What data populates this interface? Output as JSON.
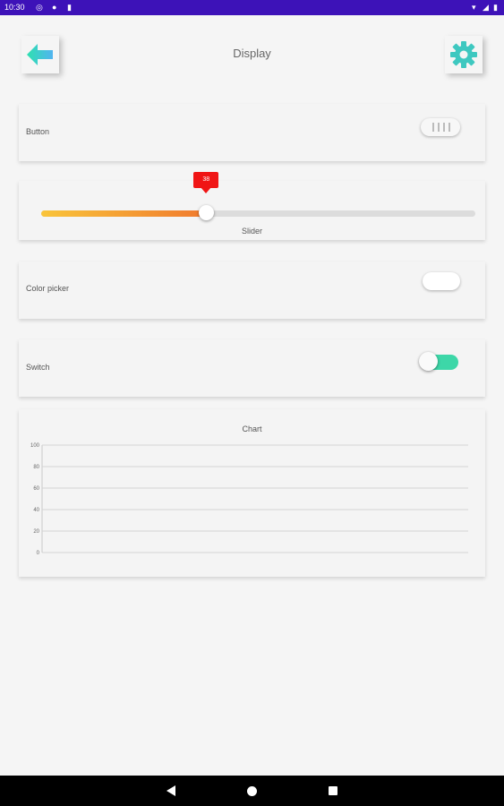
{
  "status_bar": {
    "time": "10:30"
  },
  "header": {
    "title": "Display"
  },
  "cards": {
    "button": {
      "label": "Button"
    },
    "slider": {
      "label": "Slider",
      "value": 38,
      "value_text": "38",
      "min": 0,
      "max": 100
    },
    "color_picker": {
      "label": "Color picker"
    },
    "switch": {
      "label": "Switch",
      "on": false
    }
  },
  "chart_data": {
    "type": "line",
    "title": "Chart",
    "ylim": [
      0,
      100
    ],
    "y_ticks": [
      "0",
      "20",
      "40",
      "60",
      "80",
      "100"
    ],
    "grid": true,
    "series": []
  },
  "colors": {
    "accent": "#3dd7a8",
    "status_bar": "#3d12b8",
    "slider_start": "#f9c43a",
    "slider_end": "#f07a2e",
    "slider_bubble": "#f01515"
  },
  "icons": {
    "back": "arrow-left-icon",
    "settings": "gear-icon",
    "nav_back": "triangle-back-icon",
    "nav_home": "circle-home-icon",
    "nav_recent": "square-recents-icon"
  }
}
